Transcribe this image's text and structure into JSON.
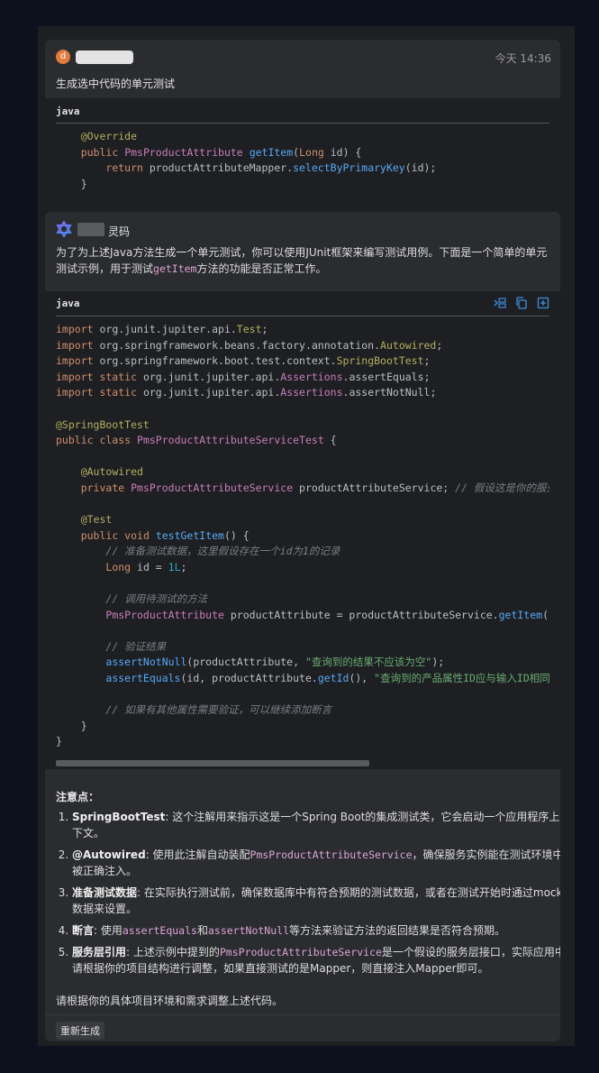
{
  "user_message": {
    "avatar_letter": "d",
    "timestamp": "今天 14:36",
    "prompt": "生成选中代码的单元测试",
    "code_lang": "java"
  },
  "bot_message": {
    "name": "灵码",
    "intro_a": "为了为上述Java方法生成一个单元测试，你可以使用JUnit框架来编写测试用例。下面是一个简单的单元测试示例，用于测试",
    "intro_code": "getItem",
    "intro_b": "方法的功能是否正常工作。",
    "code_lang": "java",
    "tool_icons": [
      "insert-icon",
      "copy-icon",
      "new-file-icon"
    ],
    "notes_title": "注意点：",
    "notes": [
      {
        "bold": "SpringBootTest",
        "text": ": 这个注解用来指示这是一个Spring Boot的集成测试类，它会启动一个应用程序上下文。"
      },
      {
        "bold": "@Autowired",
        "text_a": ": 使用此注解自动装配",
        "code": "PmsProductAttributeService",
        "text_b": "，确保服务实例能在测试环境中被正确注入。"
      },
      {
        "bold": "准备测试数据",
        "text": ": 在实际执行测试前，确保数据库中有符合预期的测试数据，或者在测试开始时通过mock数据来设置。"
      },
      {
        "bold": "断言",
        "text_a": ": 使用",
        "code1": "assertEquals",
        "text_b": "和",
        "code2": "assertNotNull",
        "text_c": "等方法来验证方法的返回结果是否符合预期。"
      },
      {
        "bold": "服务层引用",
        "text_a": ": 上述示例中提到的",
        "code": "PmsProductAttributeService",
        "text_b": "是一个假设的服务层接口，实际应用中请根据你的项目结构进行调整，如果直接测试的是Mapper，则直接注入Mapper即可。"
      }
    ],
    "closing": "请根据你的具体项目环境和需求调整上述代码。",
    "regenerate_label": "重新生成"
  }
}
